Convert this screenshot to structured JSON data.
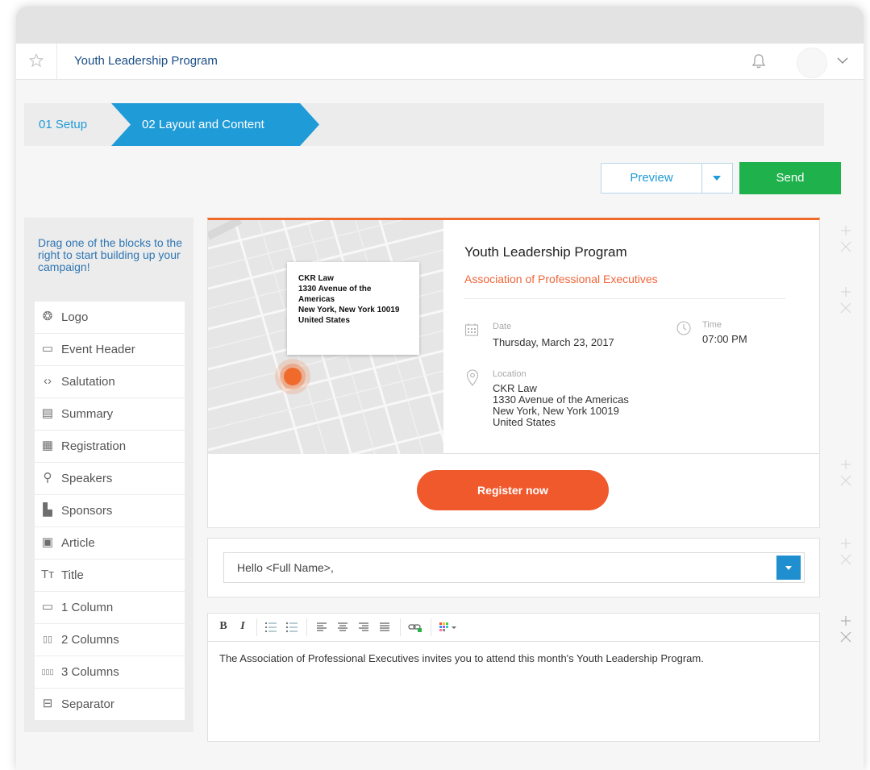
{
  "header": {
    "page_title": "Youth Leadership Program"
  },
  "wizard": {
    "step1": "01  Setup",
    "step2": "02  Layout and Content"
  },
  "actions": {
    "preview": "Preview",
    "send": "Send"
  },
  "sidebar": {
    "intro": "Drag one of the blocks to the right to start building up your campaign!",
    "items": [
      {
        "label": "Logo",
        "icon": "logo-icon",
        "glyph": "❂"
      },
      {
        "label": "Event Header",
        "icon": "event-header-icon",
        "glyph": "▭"
      },
      {
        "label": "Salutation",
        "icon": "salutation-icon",
        "glyph": "‹›"
      },
      {
        "label": "Summary",
        "icon": "summary-icon",
        "glyph": "▤"
      },
      {
        "label": "Registration",
        "icon": "registration-icon",
        "glyph": "▦"
      },
      {
        "label": "Speakers",
        "icon": "speakers-icon",
        "glyph": "⚲"
      },
      {
        "label": "Sponsors",
        "icon": "sponsors-icon",
        "glyph": "▙"
      },
      {
        "label": "Article",
        "icon": "article-icon",
        "glyph": "▣"
      },
      {
        "label": "Title",
        "icon": "title-icon",
        "glyph": "Tт"
      },
      {
        "label": "1 Column",
        "icon": "one-column-icon",
        "glyph": "▭"
      },
      {
        "label": "2 Columns",
        "icon": "two-columns-icon",
        "glyph": "▯▯"
      },
      {
        "label": "3 Columns",
        "icon": "three-columns-icon",
        "glyph": "▯▯▯"
      },
      {
        "label": "Separator",
        "icon": "separator-icon",
        "glyph": "⊟"
      }
    ]
  },
  "event": {
    "map_card": {
      "line1": "CKR Law",
      "line2": "1330 Avenue of the",
      "line3": "Americas",
      "line4": "New York, New York 10019",
      "line5": "United States"
    },
    "title": "Youth Leadership Program",
    "organization": "Association of Professional Executives",
    "date_label": "Date",
    "date_value": "Thursday, March 23, 2017",
    "time_label": "Time",
    "time_value": "07:00 PM",
    "location_label": "Location",
    "location_line1": "CKR Law",
    "location_line2": "1330 Avenue of the Americas",
    "location_line3": "New York, New York 10019",
    "location_line4": "United States"
  },
  "registration": {
    "button": "Register now"
  },
  "salutation": {
    "value": "Hello <Full Name>,"
  },
  "summary": {
    "text": "The Association of Professional Executives invites you to attend this month's Youth Leadership Program."
  },
  "colors": {
    "accent_blue": "#1f9bd7",
    "send_green": "#1fb14b",
    "register_orange": "#f0592c",
    "event_border": "#f06a2c"
  }
}
